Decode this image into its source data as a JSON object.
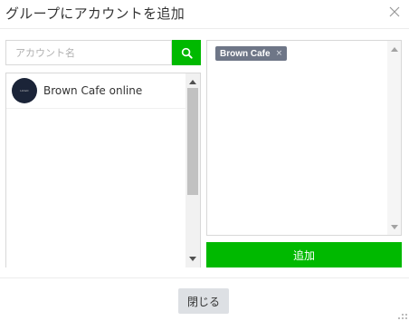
{
  "dialog": {
    "title": "グループにアカウントを追加",
    "close_icon": "close-icon"
  },
  "search": {
    "placeholder": "アカウント名",
    "value": "",
    "button_icon": "search-icon"
  },
  "accounts": [
    {
      "name": "Brown Cafe online",
      "avatar_text": "LOGO"
    }
  ],
  "selected": {
    "tags": [
      {
        "label": "Brown Cafe",
        "remove_icon": "×"
      }
    ]
  },
  "actions": {
    "add_label": "追加",
    "close_label": "閉じる"
  },
  "colors": {
    "accent": "#00b900",
    "tag_bg": "#6e7687",
    "avatar_bg": "#1b2438",
    "close_button_bg": "#dde0e4"
  }
}
